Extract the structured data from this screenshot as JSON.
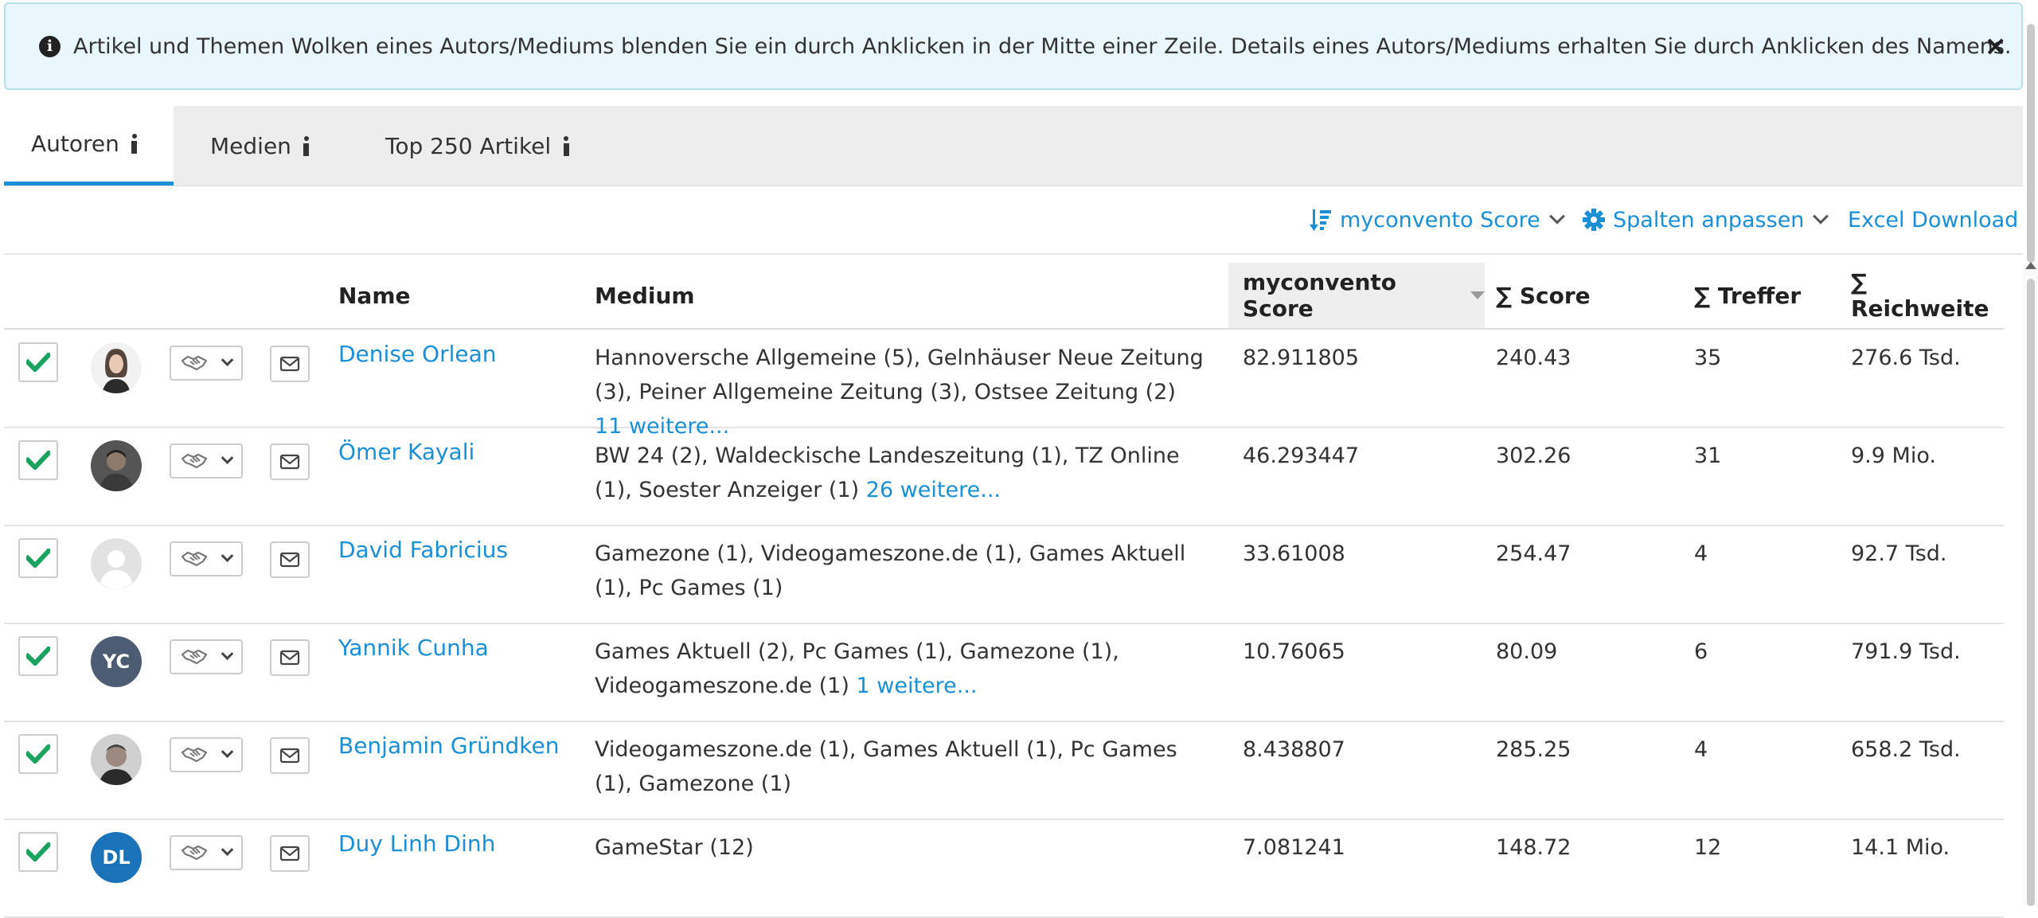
{
  "alert": {
    "icon": "info-circle-icon",
    "text": "Artikel und Themen Wolken eines Autors/Mediums blenden Sie ein durch Anklicken in der Mitte einer Zeile. Details eines Autors/Mediums erhalten Sie durch Anklicken des Namens.",
    "close": "×"
  },
  "tabs": [
    {
      "label": "Autoren",
      "icon": "info-icon",
      "active": true
    },
    {
      "label": "Medien",
      "icon": "info-icon",
      "active": false
    },
    {
      "label": "Top 250 Artikel",
      "icon": "info-icon",
      "active": false
    }
  ],
  "toolbar": {
    "sort_label": "myconvento Score",
    "sort_icon": "sort-amount-down-icon",
    "columns_label": "Spalten anpassen",
    "columns_icon": "gear-icon",
    "excel_label": "Excel Download"
  },
  "table": {
    "headers": {
      "name": "Name",
      "medium": "Medium",
      "score": "myconvento Score",
      "sum_score": "∑ Score",
      "hits": "∑ Treffer",
      "reach": "∑ Reichweite"
    },
    "rows": [
      {
        "name": "Denise Orlean",
        "avatar": "photo",
        "medium": "Hannoversche Allgemeine (5), Gelnhäuser Neue Zeitung (3), Peiner Allgemeine Zeitung (3), Ostsee Zeitung (2)",
        "more": "11 weitere...",
        "score": "82.911805",
        "sum_score": "240.43",
        "hits": "35",
        "reach": "276.6 Tsd."
      },
      {
        "name": "Ömer Kayali",
        "avatar": "photo",
        "medium": "BW 24 (2), Waldeckische Landeszeitung (1), TZ Online (1), Soester Anzeiger (1)",
        "more": "26 weitere...",
        "score": "46.293447",
        "sum_score": "302.26",
        "hits": "31",
        "reach": "9.9 Mio."
      },
      {
        "name": "David Fabricius",
        "avatar": "placeholder",
        "medium": "Gamezone (1), Videogameszone.de (1), Games Aktuell (1), Pc Games (1)",
        "more": "",
        "score": "33.61008",
        "sum_score": "254.47",
        "hits": "4",
        "reach": "92.7 Tsd."
      },
      {
        "name": "Yannik Cunha",
        "avatar": "initials",
        "initials": "YC",
        "medium": "Games Aktuell (2), Pc Games (1), Gamezone (1), Videogameszone.de (1)",
        "more": "1 weitere...",
        "score": "10.76065",
        "sum_score": "80.09",
        "hits": "6",
        "reach": "791.9 Tsd."
      },
      {
        "name": "Benjamin Gründken",
        "avatar": "photo",
        "medium": "Videogameszone.de (1), Games Aktuell (1), Pc Games (1), Gamezone (1)",
        "more": "",
        "score": "8.438807",
        "sum_score": "285.25",
        "hits": "4",
        "reach": "658.2 Tsd."
      },
      {
        "name": "Duy Linh Dinh",
        "avatar": "initials",
        "initials": "DL",
        "medium": "GameStar (12)",
        "more": "",
        "score": "7.081241",
        "sum_score": "148.72",
        "hits": "12",
        "reach": "14.1 Mio."
      }
    ]
  },
  "colors": {
    "accent": "#1a8fd6",
    "check": "#1aa260",
    "alert_bg": "#e9f6fb"
  }
}
